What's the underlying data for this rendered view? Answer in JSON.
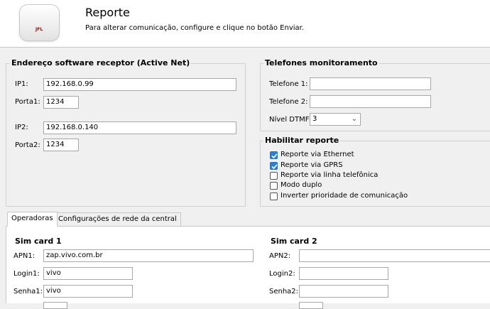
{
  "header": {
    "title": "Reporte",
    "subtitle": "Para alterar comunicação, configure e clique no botão Enviar.",
    "logo_text": "JFL",
    "logo_icon": "device-icon"
  },
  "receptor": {
    "title": "Endereço software receptor (Active Net)",
    "ip1_label": "IP1:",
    "ip1_value": "192.168.0.99",
    "porta1_label": "Porta1:",
    "porta1_value": "1234",
    "ip2_label": "IP2:",
    "ip2_value": "192.168.0.140",
    "porta2_label": "Porta2:",
    "porta2_value": "1234"
  },
  "telefones": {
    "title": "Telefones monitoramento",
    "tel1_label": "Telefone 1:",
    "tel1_value": "",
    "tel2_label": "Telefone 2:",
    "tel2_value": "",
    "dtmf_label": "Nível DTMF:",
    "dtmf_value": "3"
  },
  "habilitar": {
    "title": "Habilitar reporte",
    "options": [
      {
        "label": "Reporte via Ethernet",
        "checked": true
      },
      {
        "label": "Reporte via GPRS",
        "checked": true
      },
      {
        "label": "Reporte via linha telefônica",
        "checked": false
      },
      {
        "label": "Modo duplo",
        "checked": false
      },
      {
        "label": "Inverter prioridade de comunicação",
        "checked": false
      }
    ]
  },
  "tabs": [
    {
      "label": "Operadoras",
      "active": true
    },
    {
      "label": "Configurações de rede da central",
      "active": false
    }
  ],
  "sim1": {
    "title": "Sim card 1",
    "apn_label": "APN1:",
    "apn_value": "zap.vivo.com.br",
    "login_label": "Login1:",
    "login_value": "vivo",
    "senha_label": "Senha1:",
    "senha_value": "vivo"
  },
  "sim2": {
    "title": "Sim card 2",
    "apn_label": "APN2:",
    "apn_value": "",
    "login_label": "Login2:",
    "login_value": "",
    "senha_label": "Senha2:",
    "senha_value": ""
  },
  "colors": {
    "accent": "#2f7fd1",
    "brand": "#b00000"
  }
}
